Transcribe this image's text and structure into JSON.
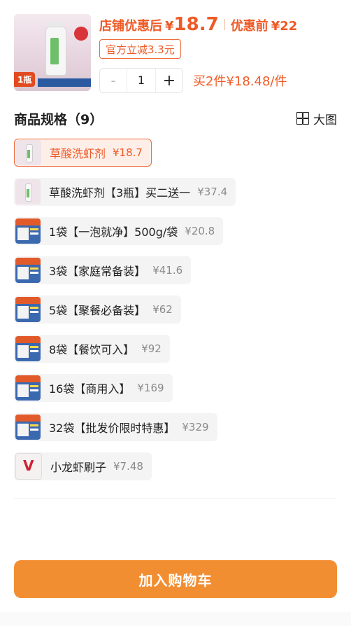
{
  "header": {
    "store_price_label": "店铺优惠后",
    "currency": "¥",
    "store_price": "18.7",
    "original_price_label": "优惠前",
    "original_price": "¥22",
    "discount_badge": "官方立减3.3元",
    "quantity": "1",
    "minus": "-",
    "plus": "+",
    "bundle_offer": "买2件¥18.48/件",
    "image_badge": "1瓶"
  },
  "spec": {
    "title": "商品规格（9）",
    "view_toggle": "大图"
  },
  "options": [
    {
      "name": "草酸洗虾剂",
      "price": "¥18.7",
      "selected": true,
      "icon": "bottle"
    },
    {
      "name": "草酸洗虾剂【3瓶】买二送一",
      "price": "¥37.4",
      "selected": false,
      "icon": "bottle"
    },
    {
      "name": "1袋【一泡就净】500g/袋",
      "price": "¥20.8",
      "selected": false,
      "icon": "bag"
    },
    {
      "name": "3袋【家庭常备装】",
      "price": "¥41.6",
      "selected": false,
      "icon": "bag"
    },
    {
      "name": "5袋【聚餐必备装】",
      "price": "¥62",
      "selected": false,
      "icon": "bag"
    },
    {
      "name": "8袋【餐饮可入】",
      "price": "¥92",
      "selected": false,
      "icon": "bag"
    },
    {
      "name": "16袋【商用入】",
      "price": "¥169",
      "selected": false,
      "icon": "bag"
    },
    {
      "name": "32袋【批发价限时特惠】",
      "price": "¥329",
      "selected": false,
      "icon": "bag"
    },
    {
      "name": "小龙虾刷子",
      "price": "¥7.48",
      "selected": false,
      "icon": "brush"
    }
  ],
  "footer": {
    "add_to_cart": "加入购物车"
  },
  "colors": {
    "accent": "#ef5a26",
    "button": "#f28e32"
  }
}
